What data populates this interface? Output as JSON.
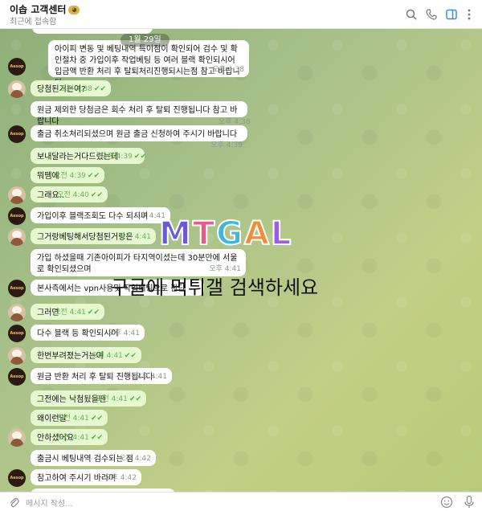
{
  "header": {
    "title": "이솝 고객센터",
    "subtitle": "최근에 접속함",
    "icons": [
      "search-icon",
      "phone-icon",
      "sidebar-icon",
      "more-vert-icon"
    ]
  },
  "date_label": "1월 29일",
  "messages": [
    {
      "text": "아이피 변동 및 베팅내역 특이점이 확인되어 검수 및 확인절차 중 가입이후 작업베팅 등 여러 블랙 확인되시어 입금액 반환 처리 후 탈퇴처리진행되시는점 참고 바랍니다",
      "time": "오후 4:38"
    },
    {
      "text": "당첨된거는여?",
      "time": "오전 4:38"
    },
    {
      "text": "원금 제외한 당첨금은 회수 처리 후 탈퇴 진행됩니다 참고 바랍니다",
      "time": "오후 4:38"
    },
    {
      "text": "출금 취소처리되셨으며 원금 출금 신청하여 주시기 바랍니다",
      "time": "오후 4:39"
    },
    {
      "text": "보내달라는거다드렸는데",
      "time": "오전 4:39"
    },
    {
      "text": "뭐뗌에",
      "time": "오전 4:39"
    },
    {
      "text": "그래요..",
      "time": "오전 4:40"
    },
    {
      "text": "가입이후 블랙조회도 다수 되시며",
      "time": "오후 4:41"
    },
    {
      "text": "그거랑베팅해서당첨된거랑은",
      "time": "오전 4:41"
    },
    {
      "text": "가입 하셨을때 기존아이피가 타지역이셨는데 30분만에 서울로 확인되셨으며",
      "time": "오후 4:41"
    },
    {
      "text": "본사측에서는 vpn사용및 작업베팅으로 판단",
      "time": ""
    },
    {
      "text": "그러면",
      "time": "오전 4:41"
    },
    {
      "text": "다수 블랙 등 확인되시어",
      "time": "오후 4:41"
    },
    {
      "text": "한번부려졌는거는여",
      "time": "오전 4:41"
    },
    {
      "text": "원금 반환 처리 후 탈퇴 진행됩니다",
      "time": "오후 4:41"
    },
    {
      "text": "그전에는 낙첨됬을땐",
      "time": "오전 4:41"
    },
    {
      "text": "왜이런말",
      "time": "오전 4:41"
    },
    {
      "text": "안하셨어요",
      "time": "오전 4:41"
    },
    {
      "text": "출금시 베팅내역 검수되는 점",
      "time": "오후 4:42"
    },
    {
      "text": "참고하여 주시기 바라며",
      "time": "오후 4:42"
    }
  ],
  "watermark": {
    "logo": [
      "M",
      "T",
      "G",
      "A",
      "L"
    ],
    "text": "구글에 먹튀갤 검색하세요"
  },
  "input": {
    "placeholder": "메시지 작성...",
    "icons": [
      "attach-icon",
      "emoji-icon",
      "mic-icon"
    ]
  },
  "colors": {
    "incoming_bubble": "#ffffff",
    "outgoing_bubble": "#e6f8cf",
    "chat_background": "#a9c28a",
    "check_color": "#5cab4d"
  }
}
